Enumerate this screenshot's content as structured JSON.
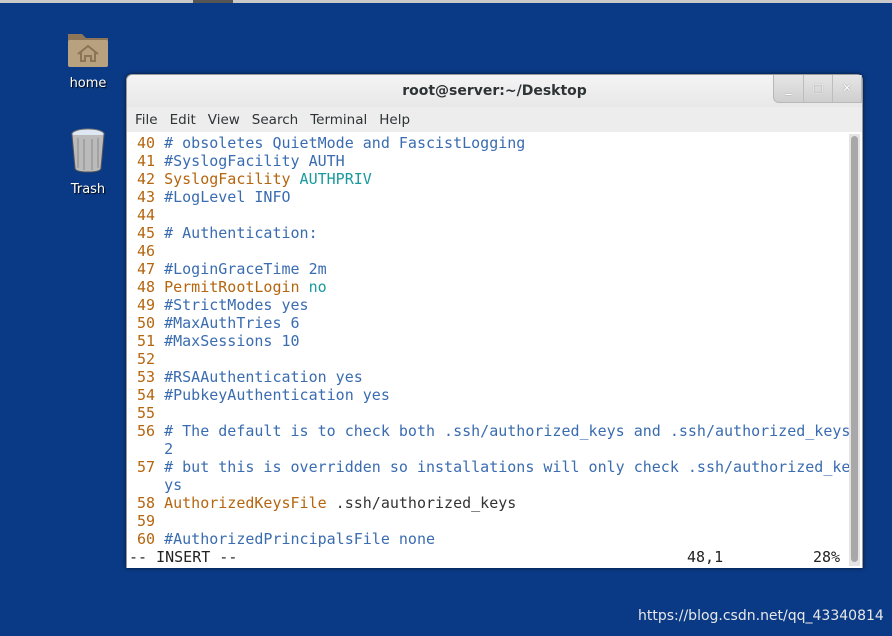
{
  "desktop": {
    "icons": [
      {
        "label": "home",
        "icon": "home-folder-icon"
      },
      {
        "label": "Trash",
        "icon": "trash-icon"
      }
    ]
  },
  "window": {
    "title": "root@server:~/Desktop",
    "buttons": {
      "minimize": "_",
      "maximize": "□",
      "close": "✕"
    }
  },
  "menu": [
    "File",
    "Edit",
    "View",
    "Search",
    "Terminal",
    "Help"
  ],
  "colors": {
    "line_number": "#b5650e",
    "keyword": "#b5650e",
    "comment": "#3a6cb0",
    "value": "#1a9a9c",
    "desktop": "#0a3a85"
  },
  "lines": [
    {
      "num": "40",
      "segs": [
        {
          "t": "# obsoletes QuietMode and FascistLogging",
          "c": "c"
        }
      ]
    },
    {
      "num": "41",
      "segs": [
        {
          "t": "#SyslogFacility AUTH",
          "c": "c"
        }
      ]
    },
    {
      "num": "42",
      "segs": [
        {
          "t": "SyslogFacility",
          "c": "k"
        },
        {
          "t": " AUTHPRIV",
          "c": "v"
        }
      ]
    },
    {
      "num": "43",
      "segs": [
        {
          "t": "#LogLevel INFO",
          "c": "c"
        }
      ]
    },
    {
      "num": "44",
      "segs": []
    },
    {
      "num": "45",
      "segs": [
        {
          "t": "# Authentication:",
          "c": "c"
        }
      ]
    },
    {
      "num": "46",
      "segs": []
    },
    {
      "num": "47",
      "segs": [
        {
          "t": "#LoginGraceTime 2m",
          "c": "c"
        }
      ]
    },
    {
      "num": "48",
      "segs": [
        {
          "t": "PermitRootLogin",
          "c": "k"
        },
        {
          "t": " no",
          "c": "v"
        }
      ]
    },
    {
      "num": "49",
      "segs": [
        {
          "t": "#StrictModes yes",
          "c": "c"
        }
      ]
    },
    {
      "num": "50",
      "segs": [
        {
          "t": "#MaxAuthTries 6",
          "c": "c"
        }
      ]
    },
    {
      "num": "51",
      "segs": [
        {
          "t": "#MaxSessions 10",
          "c": "c"
        }
      ]
    },
    {
      "num": "52",
      "segs": []
    },
    {
      "num": "53",
      "segs": [
        {
          "t": "#RSAAuthentication yes",
          "c": "c"
        }
      ]
    },
    {
      "num": "54",
      "segs": [
        {
          "t": "#PubkeyAuthentication yes",
          "c": "c"
        }
      ]
    },
    {
      "num": "55",
      "segs": []
    },
    {
      "num": "56",
      "segs": [
        {
          "t": "# The default is to check both .ssh/authorized_keys and .ssh/authorized_keys",
          "c": "c"
        }
      ]
    },
    {
      "num": "",
      "segs": [
        {
          "t": "2",
          "c": "c"
        }
      ]
    },
    {
      "num": "57",
      "segs": [
        {
          "t": "# but this is overridden so installations will only check .ssh/authorized_ke",
          "c": "c"
        }
      ]
    },
    {
      "num": "",
      "segs": [
        {
          "t": "ys",
          "c": "c"
        }
      ]
    },
    {
      "num": "58",
      "segs": [
        {
          "t": "AuthorizedKeysFile",
          "c": "k"
        },
        {
          "t": " .ssh/authorized_keys",
          "c": "t"
        }
      ]
    },
    {
      "num": "59",
      "segs": []
    },
    {
      "num": "60",
      "segs": [
        {
          "t": "#AuthorizedPrincipalsFile none",
          "c": "c"
        }
      ]
    }
  ],
  "status": {
    "mode": "-- INSERT --",
    "position": "48,1",
    "percent": "28%"
  },
  "watermark": "https://blog.csdn.net/qq_43340814"
}
